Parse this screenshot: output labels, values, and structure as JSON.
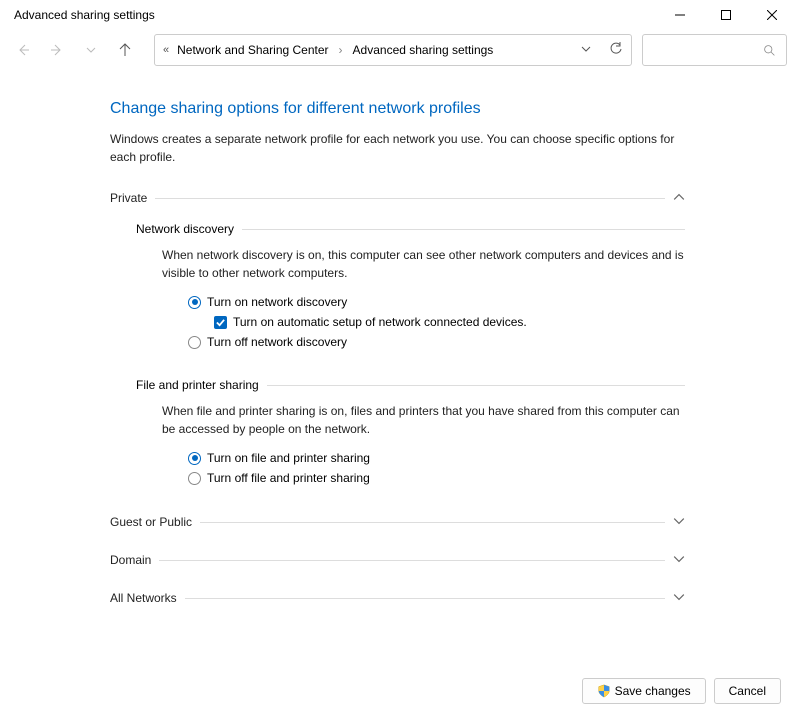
{
  "window": {
    "title": "Advanced sharing settings"
  },
  "breadcrumb": {
    "parent": "Network and Sharing Center",
    "current": "Advanced sharing settings"
  },
  "page": {
    "heading": "Change sharing options for different network profiles",
    "subtext": "Windows creates a separate network profile for each network you use. You can choose specific options for each profile."
  },
  "sections": {
    "private": {
      "label": "Private",
      "network_discovery": {
        "title": "Network discovery",
        "body": "When network discovery is on, this computer can see other network computers and devices and is visible to other network computers.",
        "opt_on": "Turn on network discovery",
        "opt_auto": "Turn on automatic setup of network connected devices.",
        "opt_off": "Turn off network discovery"
      },
      "file_printer": {
        "title": "File and printer sharing",
        "body": "When file and printer sharing is on, files and printers that you have shared from this computer can be accessed by people on the network.",
        "opt_on": "Turn on file and printer sharing",
        "opt_off": "Turn off file and printer sharing"
      }
    },
    "guest": {
      "label": "Guest or Public"
    },
    "domain": {
      "label": "Domain"
    },
    "all": {
      "label": "All Networks"
    }
  },
  "buttons": {
    "save": "Save changes",
    "cancel": "Cancel"
  }
}
